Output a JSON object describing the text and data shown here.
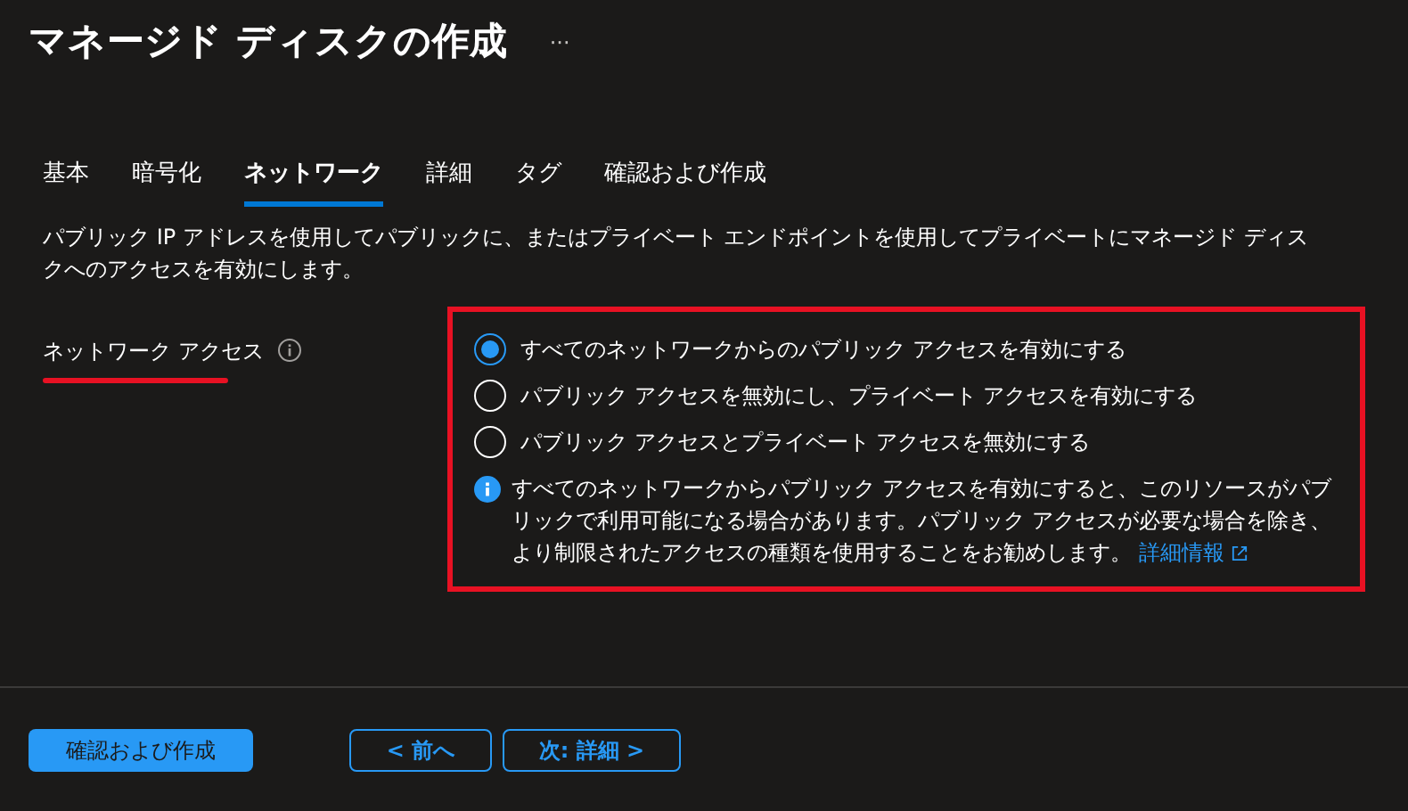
{
  "header": {
    "title": "マネージド ディスクの作成",
    "more": "···"
  },
  "tabs": [
    {
      "label": "基本",
      "selected": false
    },
    {
      "label": "暗号化",
      "selected": false
    },
    {
      "label": "ネットワーク",
      "selected": true
    },
    {
      "label": "詳細",
      "selected": false
    },
    {
      "label": "タグ",
      "selected": false
    },
    {
      "label": "確認および作成",
      "selected": false
    }
  ],
  "description": "パブリック IP アドレスを使用してパブリックに、またはプライベート エンドポイントを使用してプライベートにマネージド ディスクへのアクセスを有効にします。",
  "network_access": {
    "label": "ネットワーク アクセス",
    "options": [
      {
        "label": "すべてのネットワークからのパブリック アクセスを有効にする",
        "selected": true
      },
      {
        "label": "パブリック アクセスを無効にし、プライベート アクセスを有効にする",
        "selected": false
      },
      {
        "label": "パブリック アクセスとプライベート アクセスを無効にする",
        "selected": false
      }
    ],
    "info": "すべてのネットワークからパブリック アクセスを有効にすると、このリソースがパブリックで利用可能になる場合があります。パブリック アクセスが必要な場合を除き、より制限されたアクセスの種類を使用することをお勧めします。",
    "info_link": "詳細情報"
  },
  "footer": {
    "buttons": [
      {
        "label": "確認および作成",
        "kind": "primary"
      },
      {
        "label": "< 前へ",
        "kind": "secondary"
      },
      {
        "label": "次: 詳細 >",
        "kind": "secondary"
      }
    ]
  }
}
